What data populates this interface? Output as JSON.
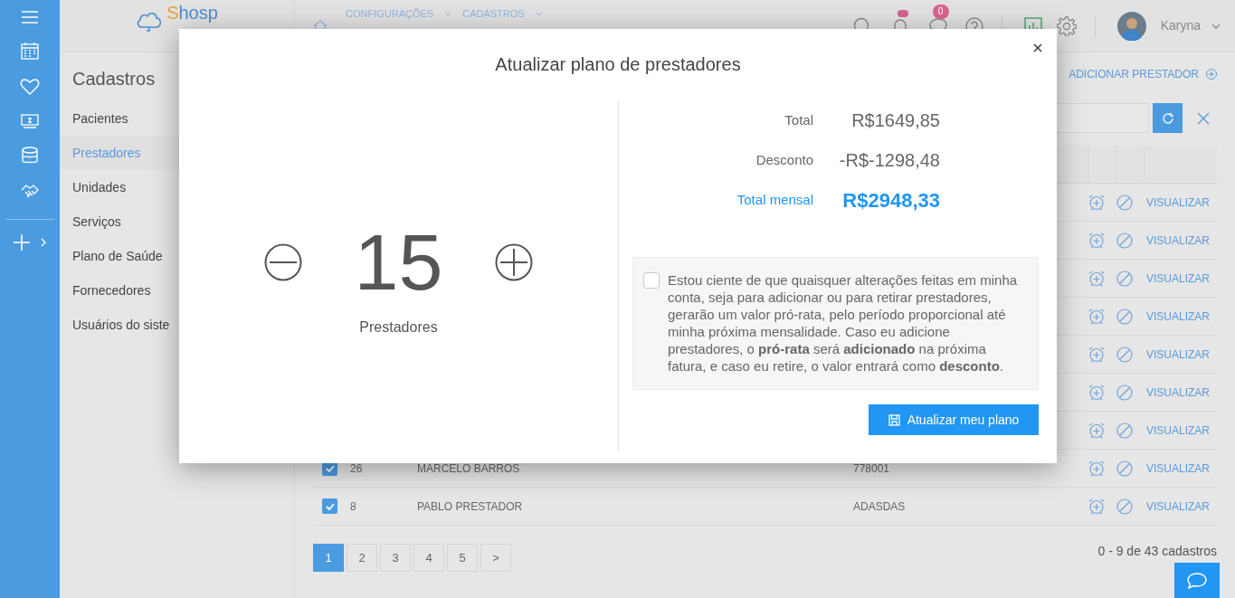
{
  "logo": {
    "text": "Shosp"
  },
  "breadcrumb": [
    "CONFIGURAÇÕES",
    "CADASTROS"
  ],
  "topbar": {
    "messages_badge": "0",
    "user": "Karyna"
  },
  "sidebar": {
    "title": "Cadastros",
    "items": [
      {
        "label": "Pacientes",
        "selected": false
      },
      {
        "label": "Prestadores",
        "selected": true
      },
      {
        "label": "Unidades",
        "selected": false
      },
      {
        "label": "Serviços",
        "selected": false
      },
      {
        "label": "Plano de Saúde",
        "selected": false
      },
      {
        "label": "Fornecedores",
        "selected": false
      },
      {
        "label": "Usuários do siste",
        "selected": false
      }
    ]
  },
  "add_button": "ADICIONAR PRESTADOR",
  "table": {
    "rows": [
      {
        "action": "VISUALIZAR"
      },
      {
        "action": "VISUALIZAR"
      },
      {
        "action": "VISUALIZAR"
      },
      {
        "action": "VISUALIZAR"
      },
      {
        "action": "VISUALIZAR"
      },
      {
        "action": "VISUALIZAR"
      },
      {
        "action": "VISUALIZAR"
      },
      {
        "checked": true,
        "id": "26",
        "name": "MARCELO BARROS",
        "code": "778001",
        "action": "VISUALIZAR"
      },
      {
        "checked": true,
        "id": "8",
        "name": "PABLO PRESTADOR",
        "code": "ADASDAS",
        "action": "VISUALIZAR"
      }
    ]
  },
  "pagination": {
    "pages": [
      {
        "label": "1",
        "selected": true
      },
      {
        "label": "2",
        "selected": false
      },
      {
        "label": "3",
        "selected": false
      },
      {
        "label": "4",
        "selected": false
      },
      {
        "label": "5",
        "selected": false
      },
      {
        "label": ">",
        "selected": false
      }
    ],
    "summary": "0 - 9 de 43 cadastros"
  },
  "modal": {
    "title": "Atualizar plano de prestadores",
    "count": "15",
    "count_label": "Prestadores",
    "totals": [
      {
        "label": "Total",
        "value": "R$1649,85",
        "kind": "normal"
      },
      {
        "label": "Desconto",
        "value": "-R$-1298,48",
        "kind": "normal"
      },
      {
        "label": "Total mensal",
        "value": "R$2948,33",
        "kind": "highlight"
      }
    ],
    "notice": {
      "checked": false,
      "text": "Estou ciente de que quaisquer alterações feitas em minha conta, seja para adicionar ou para retirar prestadores, gerarão um valor pró-rata, pelo período proporcional até minha próxima mensalidade. Caso eu adicione prestadores, o **pró-rata** será **adicionado** na próxima fatura, e caso eu retire, o valor entrará como **desconto**."
    },
    "submit": "Atualizar meu plano"
  }
}
